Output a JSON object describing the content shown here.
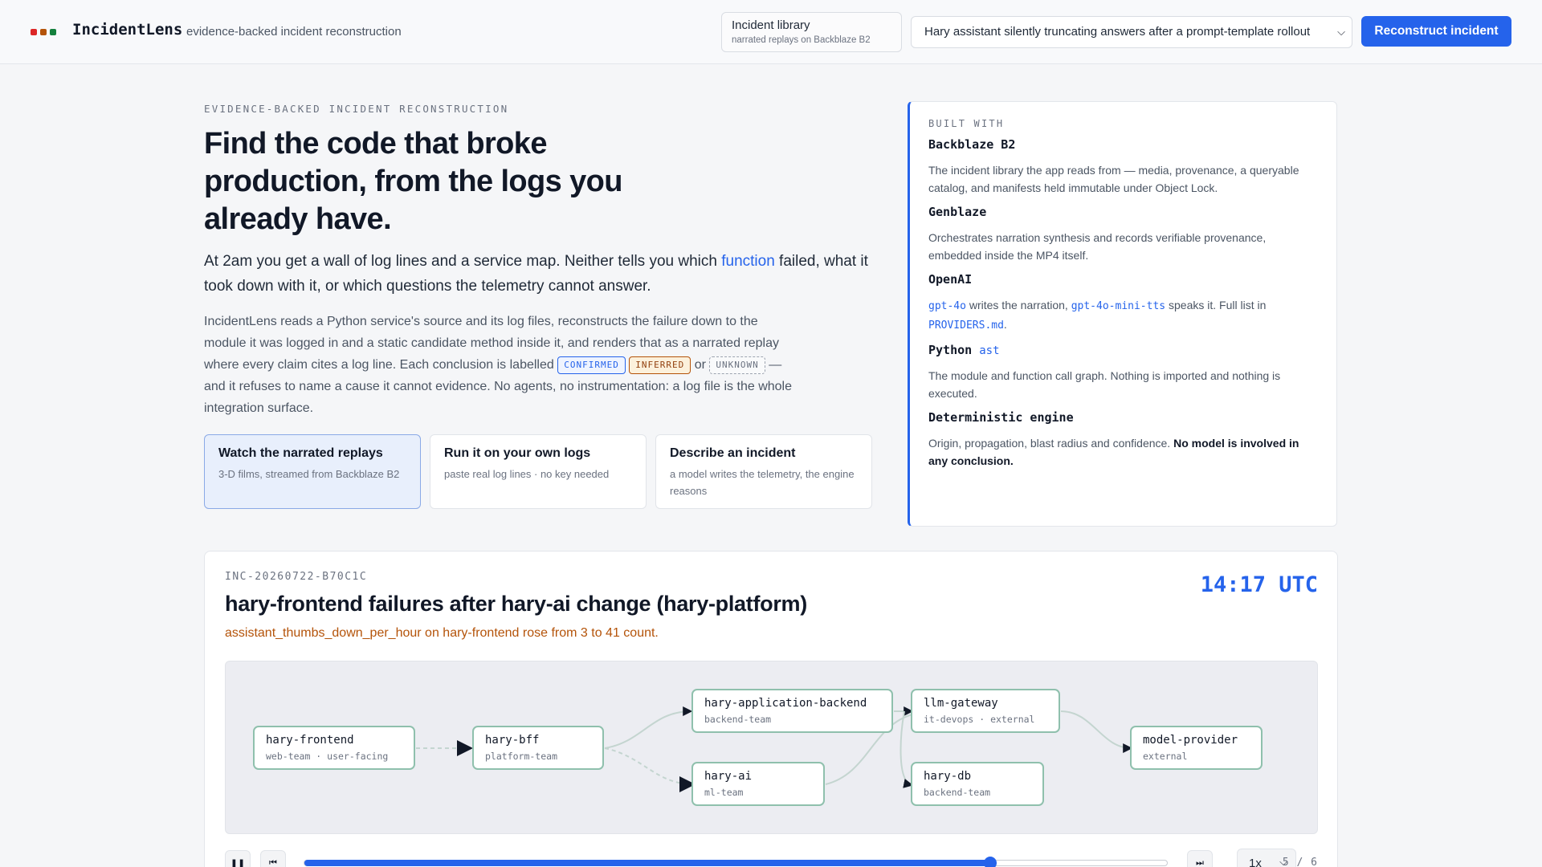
{
  "header": {
    "brand": "IncidentLens",
    "tagline": "evidence-backed incident reconstruction",
    "logo_colors": [
      "#dc2626",
      "#b45309",
      "#15803d"
    ],
    "library_button": {
      "title": "Incident library",
      "subtitle": "narrated replays on Backblaze B2"
    },
    "incident_select": {
      "value": "Hary assistant silently truncating answers after a prompt-template rollout"
    },
    "primary_button": "Reconstruct incident"
  },
  "hero": {
    "eyebrow": "EVIDENCE-BACKED INCIDENT RECONSTRUCTION",
    "title": "Find the code that broke production, from the logs you already have.",
    "lead_before": "At 2am you get a wall of log lines and a service map. Neither tells you which ",
    "lead_link": "function",
    "lead_after": " failed, what it took down with it, or which questions the telemetry cannot answer.",
    "body_1": "IncidentLens reads a Python service's source and its log files, reconstructs the failure down to the module it was logged in and a static candidate method inside it, and renders that as a narrated replay where every claim cites a log line. Each conclusion is labelled ",
    "tag_confirmed": "CONFIRMED",
    "tag_inferred": "INFERRED",
    "or": " or ",
    "tag_unknown": "UNKNOWN",
    "body_2": " — and it refuses to name a cause it cannot evidence. No agents, no instrumentation: a log file is the whole integration surface.",
    "cards": [
      {
        "title": "Watch the narrated replays",
        "subtitle": "3-D films, streamed from Backblaze B2",
        "active": true
      },
      {
        "title": "Run it on your own logs",
        "subtitle": "paste real log lines · no key needed",
        "active": false
      },
      {
        "title": "Describe an incident",
        "subtitle": "a model writes the telemetry, the engine reasons",
        "active": false
      }
    ]
  },
  "built_with": {
    "heading": "BUILT WITH",
    "items": [
      {
        "name": "Backblaze B2",
        "desc": "The incident library the app reads from — media, provenance, a queryable catalog, and manifests held immutable under Object Lock."
      },
      {
        "name": "Genblaze",
        "desc": "Orchestrates narration synthesis and records verifiable provenance, embedded inside the MP4 itself."
      },
      {
        "name": "OpenAI",
        "code_1": "gpt-4o",
        "text_1": " writes the narration, ",
        "code_2": "gpt-4o-mini-tts",
        "text_2": " speaks it. Full list in ",
        "code_3": "PROVIDERS.md",
        "text_3": "."
      },
      {
        "name": "Python",
        "name_code": "ast",
        "desc": "The module and function call graph. Nothing is imported and nothing is executed."
      },
      {
        "name": "Deterministic engine",
        "desc": "Origin, propagation, blast radius and confidence. ",
        "desc_strong": "No model is involved in any conclusion."
      }
    ]
  },
  "incident": {
    "id": "INC-20260722-B70C1C",
    "title": "hary-frontend failures after hary-ai change (hary-platform)",
    "subtitle": "assistant_thumbs_down_per_hour on hary-frontend rose from 3 to 41 count.",
    "clock": "14:17 UTC",
    "nodes": [
      {
        "name": "hary-frontend",
        "meta": "web-team · user-facing"
      },
      {
        "name": "hary-bff",
        "meta": "platform-team"
      },
      {
        "name": "hary-application-backend",
        "meta": "backend-team"
      },
      {
        "name": "hary-ai",
        "meta": "ml-team"
      },
      {
        "name": "llm-gateway",
        "meta": "it-devops · external"
      },
      {
        "name": "hary-db",
        "meta": "backend-team"
      },
      {
        "name": "model-provider",
        "meta": "external"
      }
    ],
    "node_border_color": "#8fc0ad",
    "accent_color": "#2563eb",
    "controls": {
      "play_icon": "pause-icon",
      "progress": 0.795,
      "speed": "1x",
      "step": "5 / 6"
    }
  }
}
